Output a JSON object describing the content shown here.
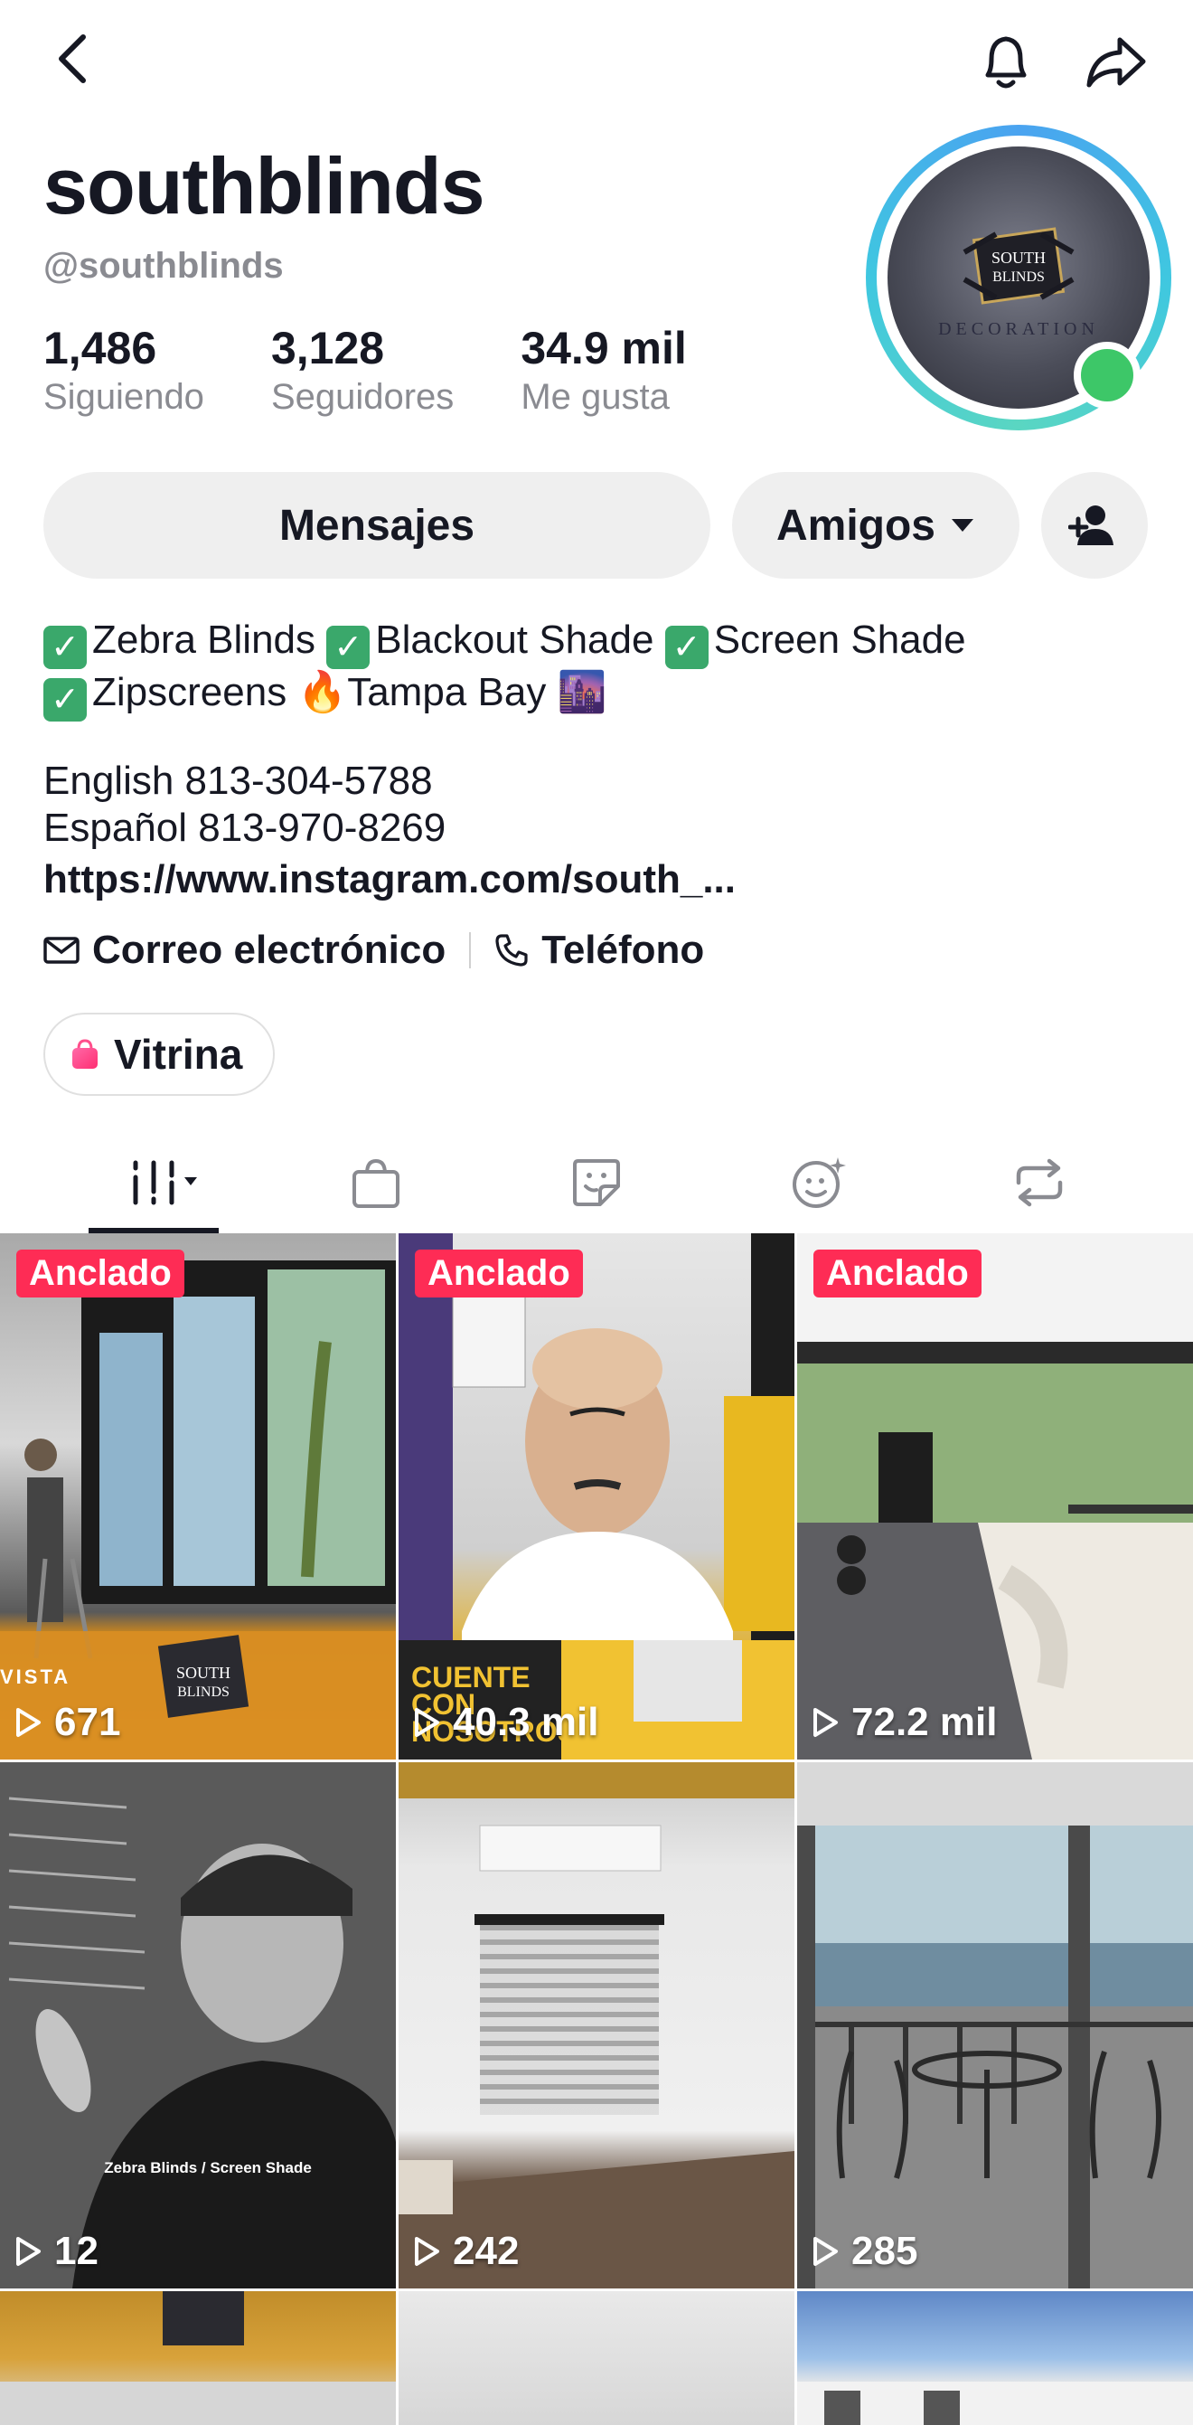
{
  "header": {
    "username": "southblinds",
    "handle": "@southblinds",
    "icons": [
      "back-icon",
      "bell-icon",
      "share-icon"
    ]
  },
  "stats": [
    {
      "value": "1,486",
      "label": "Siguiendo"
    },
    {
      "value": "3,128",
      "label": "Seguidores"
    },
    {
      "value": "34.9 mil",
      "label": "Me gusta"
    }
  ],
  "avatar": {
    "text_top": "SOUTH BLINDS",
    "text_bottom": "DECORATION"
  },
  "actions": {
    "messages_label": "Mensajes",
    "friends_label": "Amigos"
  },
  "bio": {
    "line1_items": [
      "Zebra Blinds",
      "Blackout Shade",
      "Screen Shade"
    ],
    "line2_items": [
      "Zipscreens",
      "🔥Tampa Bay",
      "🌆"
    ],
    "phone_en": "English 813-304-5788",
    "phone_es": "Español 813-970-8269",
    "link": "https://www.instagram.com/south_..."
  },
  "meta": {
    "email_label": "Correo electrónico",
    "phone_label": "Teléfono"
  },
  "showcase_label": "Vitrina",
  "tabs": [
    "videos-tab",
    "shop-tab",
    "stickers-tab",
    "favorites-tab",
    "reposts-tab"
  ],
  "videos": [
    {
      "pinned": "Anclado",
      "views": "671",
      "overlay": "VISTA"
    },
    {
      "pinned": "Anclado",
      "views": "40.3 mil",
      "overlay": "CUENTE CON NOSOTROS"
    },
    {
      "pinned": "Anclado",
      "views": "72.2 mil",
      "overlay": ""
    },
    {
      "pinned": "",
      "views": "12",
      "overlay": "Zebra Blinds / Screen Shade"
    },
    {
      "pinned": "",
      "views": "242",
      "overlay": ""
    },
    {
      "pinned": "",
      "views": "285",
      "overlay": ""
    }
  ],
  "colors": {
    "pin": "#fe2c55",
    "online": "#3dc768",
    "secondary_text": "#8a8b91"
  }
}
